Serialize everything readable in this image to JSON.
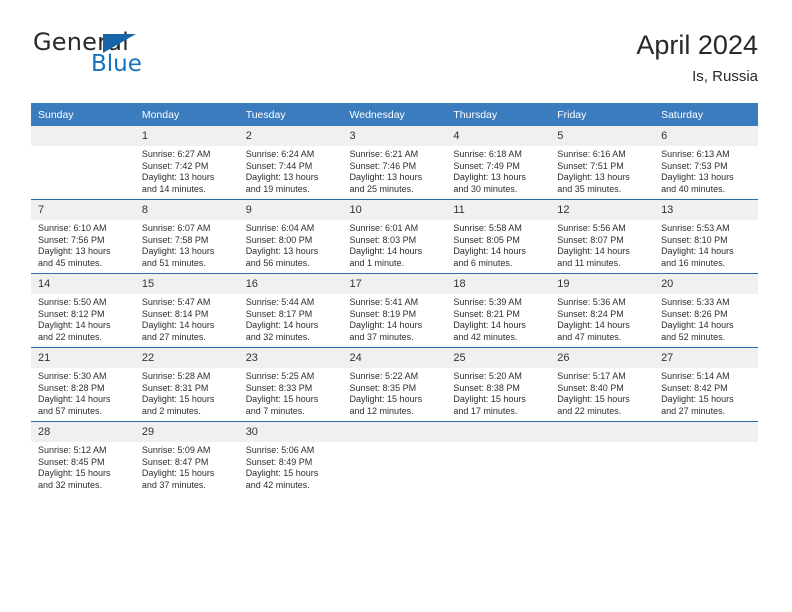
{
  "brand": {
    "name_top": "General",
    "name_bottom": "Blue",
    "triangle_icon": "blue-triangle-logo-mark",
    "accent_blue": "#1673be"
  },
  "header": {
    "month_title": "April 2024",
    "location": "Is, Russia"
  },
  "theme": {
    "header_blue": "#3a7cbe",
    "row_divider_blue": "#2e6fab",
    "daynum_band": "#f0f0f0"
  },
  "calendar": {
    "weekday_headers": [
      "Sunday",
      "Monday",
      "Tuesday",
      "Wednesday",
      "Thursday",
      "Friday",
      "Saturday"
    ],
    "weeks": [
      [
        {
          "day": "",
          "sunrise": "",
          "sunset": "",
          "daylight": "",
          "daylight2": ""
        },
        {
          "day": "1",
          "sunrise": "Sunrise: 6:27 AM",
          "sunset": "Sunset: 7:42 PM",
          "daylight": "Daylight: 13 hours",
          "daylight2": "and 14 minutes."
        },
        {
          "day": "2",
          "sunrise": "Sunrise: 6:24 AM",
          "sunset": "Sunset: 7:44 PM",
          "daylight": "Daylight: 13 hours",
          "daylight2": "and 19 minutes."
        },
        {
          "day": "3",
          "sunrise": "Sunrise: 6:21 AM",
          "sunset": "Sunset: 7:46 PM",
          "daylight": "Daylight: 13 hours",
          "daylight2": "and 25 minutes."
        },
        {
          "day": "4",
          "sunrise": "Sunrise: 6:18 AM",
          "sunset": "Sunset: 7:49 PM",
          "daylight": "Daylight: 13 hours",
          "daylight2": "and 30 minutes."
        },
        {
          "day": "5",
          "sunrise": "Sunrise: 6:16 AM",
          "sunset": "Sunset: 7:51 PM",
          "daylight": "Daylight: 13 hours",
          "daylight2": "and 35 minutes."
        },
        {
          "day": "6",
          "sunrise": "Sunrise: 6:13 AM",
          "sunset": "Sunset: 7:53 PM",
          "daylight": "Daylight: 13 hours",
          "daylight2": "and 40 minutes."
        }
      ],
      [
        {
          "day": "7",
          "sunrise": "Sunrise: 6:10 AM",
          "sunset": "Sunset: 7:56 PM",
          "daylight": "Daylight: 13 hours",
          "daylight2": "and 45 minutes."
        },
        {
          "day": "8",
          "sunrise": "Sunrise: 6:07 AM",
          "sunset": "Sunset: 7:58 PM",
          "daylight": "Daylight: 13 hours",
          "daylight2": "and 51 minutes."
        },
        {
          "day": "9",
          "sunrise": "Sunrise: 6:04 AM",
          "sunset": "Sunset: 8:00 PM",
          "daylight": "Daylight: 13 hours",
          "daylight2": "and 56 minutes."
        },
        {
          "day": "10",
          "sunrise": "Sunrise: 6:01 AM",
          "sunset": "Sunset: 8:03 PM",
          "daylight": "Daylight: 14 hours",
          "daylight2": "and 1 minute."
        },
        {
          "day": "11",
          "sunrise": "Sunrise: 5:58 AM",
          "sunset": "Sunset: 8:05 PM",
          "daylight": "Daylight: 14 hours",
          "daylight2": "and 6 minutes."
        },
        {
          "day": "12",
          "sunrise": "Sunrise: 5:56 AM",
          "sunset": "Sunset: 8:07 PM",
          "daylight": "Daylight: 14 hours",
          "daylight2": "and 11 minutes."
        },
        {
          "day": "13",
          "sunrise": "Sunrise: 5:53 AM",
          "sunset": "Sunset: 8:10 PM",
          "daylight": "Daylight: 14 hours",
          "daylight2": "and 16 minutes."
        }
      ],
      [
        {
          "day": "14",
          "sunrise": "Sunrise: 5:50 AM",
          "sunset": "Sunset: 8:12 PM",
          "daylight": "Daylight: 14 hours",
          "daylight2": "and 22 minutes."
        },
        {
          "day": "15",
          "sunrise": "Sunrise: 5:47 AM",
          "sunset": "Sunset: 8:14 PM",
          "daylight": "Daylight: 14 hours",
          "daylight2": "and 27 minutes."
        },
        {
          "day": "16",
          "sunrise": "Sunrise: 5:44 AM",
          "sunset": "Sunset: 8:17 PM",
          "daylight": "Daylight: 14 hours",
          "daylight2": "and 32 minutes."
        },
        {
          "day": "17",
          "sunrise": "Sunrise: 5:41 AM",
          "sunset": "Sunset: 8:19 PM",
          "daylight": "Daylight: 14 hours",
          "daylight2": "and 37 minutes."
        },
        {
          "day": "18",
          "sunrise": "Sunrise: 5:39 AM",
          "sunset": "Sunset: 8:21 PM",
          "daylight": "Daylight: 14 hours",
          "daylight2": "and 42 minutes."
        },
        {
          "day": "19",
          "sunrise": "Sunrise: 5:36 AM",
          "sunset": "Sunset: 8:24 PM",
          "daylight": "Daylight: 14 hours",
          "daylight2": "and 47 minutes."
        },
        {
          "day": "20",
          "sunrise": "Sunrise: 5:33 AM",
          "sunset": "Sunset: 8:26 PM",
          "daylight": "Daylight: 14 hours",
          "daylight2": "and 52 minutes."
        }
      ],
      [
        {
          "day": "21",
          "sunrise": "Sunrise: 5:30 AM",
          "sunset": "Sunset: 8:28 PM",
          "daylight": "Daylight: 14 hours",
          "daylight2": "and 57 minutes."
        },
        {
          "day": "22",
          "sunrise": "Sunrise: 5:28 AM",
          "sunset": "Sunset: 8:31 PM",
          "daylight": "Daylight: 15 hours",
          "daylight2": "and 2 minutes."
        },
        {
          "day": "23",
          "sunrise": "Sunrise: 5:25 AM",
          "sunset": "Sunset: 8:33 PM",
          "daylight": "Daylight: 15 hours",
          "daylight2": "and 7 minutes."
        },
        {
          "day": "24",
          "sunrise": "Sunrise: 5:22 AM",
          "sunset": "Sunset: 8:35 PM",
          "daylight": "Daylight: 15 hours",
          "daylight2": "and 12 minutes."
        },
        {
          "day": "25",
          "sunrise": "Sunrise: 5:20 AM",
          "sunset": "Sunset: 8:38 PM",
          "daylight": "Daylight: 15 hours",
          "daylight2": "and 17 minutes."
        },
        {
          "day": "26",
          "sunrise": "Sunrise: 5:17 AM",
          "sunset": "Sunset: 8:40 PM",
          "daylight": "Daylight: 15 hours",
          "daylight2": "and 22 minutes."
        },
        {
          "day": "27",
          "sunrise": "Sunrise: 5:14 AM",
          "sunset": "Sunset: 8:42 PM",
          "daylight": "Daylight: 15 hours",
          "daylight2": "and 27 minutes."
        }
      ],
      [
        {
          "day": "28",
          "sunrise": "Sunrise: 5:12 AM",
          "sunset": "Sunset: 8:45 PM",
          "daylight": "Daylight: 15 hours",
          "daylight2": "and 32 minutes."
        },
        {
          "day": "29",
          "sunrise": "Sunrise: 5:09 AM",
          "sunset": "Sunset: 8:47 PM",
          "daylight": "Daylight: 15 hours",
          "daylight2": "and 37 minutes."
        },
        {
          "day": "30",
          "sunrise": "Sunrise: 5:06 AM",
          "sunset": "Sunset: 8:49 PM",
          "daylight": "Daylight: 15 hours",
          "daylight2": "and 42 minutes."
        },
        {
          "day": "",
          "sunrise": "",
          "sunset": "",
          "daylight": "",
          "daylight2": ""
        },
        {
          "day": "",
          "sunrise": "",
          "sunset": "",
          "daylight": "",
          "daylight2": ""
        },
        {
          "day": "",
          "sunrise": "",
          "sunset": "",
          "daylight": "",
          "daylight2": ""
        },
        {
          "day": "",
          "sunrise": "",
          "sunset": "",
          "daylight": "",
          "daylight2": ""
        }
      ]
    ]
  }
}
